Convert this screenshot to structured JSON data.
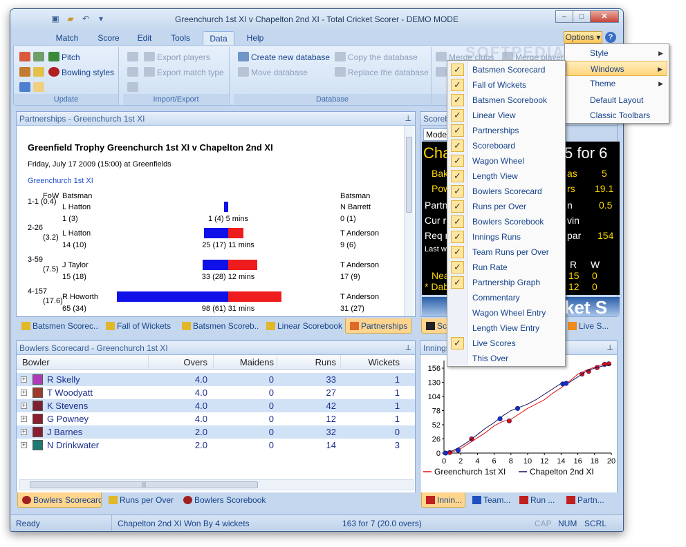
{
  "window": {
    "title": "Greenchurch 1st XI v Chapelton 2nd XI - Total Cricket Scorer - DEMO MODE"
  },
  "qat": {
    "more": "▾"
  },
  "ribbon_tabs": [
    "Match",
    "Score",
    "Edit",
    "Tools",
    "Data",
    "Help"
  ],
  "options_label": "Options ▾",
  "help_label": "?",
  "ribbon": {
    "update": {
      "label": "Update",
      "pitch": "Pitch",
      "bowling_styles": "Bowling styles"
    },
    "import_export": {
      "label": "Import/Export",
      "export_players": "Export players",
      "export_match_type": "Export match type"
    },
    "database": {
      "label": "Database",
      "create": "Create new database",
      "move": "Move database",
      "copy": "Copy the database",
      "replace": "Replace the database"
    },
    "merge_clubs": "Merge clubs",
    "merge_players": "Merge players"
  },
  "partnerships": {
    "header": "Partnerships - Greenchurch 1st XI",
    "title": "Greenfield Trophy Greenchurch 1st XI v Chapelton 2nd XI",
    "date": "Friday, July 17 2009 (15:00) at Greenfields",
    "team": "Greenchurch 1st XI",
    "col_fow": "FoW",
    "col_batsman": "Batsman",
    "col_batsman2": "Batsman",
    "rows": [
      {
        "fow": "1-1 (0.4)",
        "fow2": "",
        "b1": "L Hatton",
        "b1s": "1 (3)",
        "total": "1 (4) 5 mins",
        "b2": "N Barrett",
        "b2s": "0 (1)",
        "left": 1,
        "right": 0
      },
      {
        "fow": "2-26",
        "fow2": "(3.2)",
        "b1": "L Hatton",
        "b1s": "14 (10)",
        "total": "25 (17) 11 mins",
        "b2": "T Anderson",
        "b2s": "9 (6)",
        "left": 14,
        "right": 9
      },
      {
        "fow": "3-59",
        "fow2": "(7.5)",
        "b1": "J Taylor",
        "b1s": "15 (18)",
        "total": "33 (28) 12 mins",
        "b2": "T Anderson",
        "b2s": "17 (9)",
        "left": 15,
        "right": 17
      },
      {
        "fow": "4-157",
        "fow2": "(17.6)",
        "b1": "R Howorth",
        "b1s": "65 (34)",
        "total": "98 (61) 31 mins",
        "b2": "T Anderson",
        "b2s": "31 (27)",
        "left": 65,
        "right": 31
      }
    ]
  },
  "top_tabs": [
    "Batsmen Scorec...",
    "Fall of Wickets",
    "Batsmen Scoreb...",
    "Linear Scorebook",
    "Partnerships"
  ],
  "bowlers": {
    "header": "Bowlers Scorecard - Greenchurch 1st XI",
    "columns": [
      "Bowler",
      "Overs",
      "Maidens",
      "Runs",
      "Wickets"
    ],
    "rows": [
      {
        "name": "R Skelly",
        "overs": "4.0",
        "maidens": "0",
        "runs": "33",
        "wickets": "1",
        "color": "#b03ab8"
      },
      {
        "name": "T Woodyatt",
        "overs": "4.0",
        "maidens": "0",
        "runs": "27",
        "wickets": "1",
        "color": "#9e3a2a"
      },
      {
        "name": "K Stevens",
        "overs": "4.0",
        "maidens": "0",
        "runs": "42",
        "wickets": "1",
        "color": "#7a2030"
      },
      {
        "name": "G Powney",
        "overs": "4.0",
        "maidens": "0",
        "runs": "12",
        "wickets": "1",
        "color": "#8a1e2e"
      },
      {
        "name": "J Barnes",
        "overs": "2.0",
        "maidens": "0",
        "runs": "32",
        "wickets": "0",
        "color": "#8a1e2e"
      },
      {
        "name": "N Drinkwater",
        "overs": "2.0",
        "maidens": "0",
        "runs": "14",
        "wickets": "3",
        "color": "#1b7a72"
      }
    ]
  },
  "bottom_tabs": [
    "Bowlers Scorecard",
    "Runs per Over",
    "Bowlers Scorebook"
  ],
  "scoreboard": {
    "header": "Scorebo",
    "mode": "Mode",
    "team": "Cha",
    "score": "5 for 6",
    "lines": [
      {
        "l": "Bak",
        "r": "as",
        "v": "5"
      },
      {
        "l": "Pow",
        "r": "rs",
        "v": "19.1"
      },
      {
        "l": "Partn",
        "r": "n",
        "v": "0.5"
      },
      {
        "l": "Cur r",
        "r": "vin",
        "v": ""
      },
      {
        "l": "Req r",
        "r": "par",
        "v": "154"
      }
    ],
    "last": "Last w",
    "rw": {
      "r": "R",
      "w": "W"
    },
    "near": "Near",
    "near_r": "15",
    "near_w": "0",
    "dab": "* Dab",
    "dab_r": "12",
    "dab_w": "0",
    "banner": "ket S"
  },
  "right_tabs_top": [
    "Sco",
    "Live S..."
  ],
  "innings_header": "Innings",
  "right_tabs_bottom": [
    "Innin...",
    "Team...",
    "Run ...",
    "Partn..."
  ],
  "chart_data": {
    "type": "line",
    "title": "",
    "xlabel": "",
    "ylabel": "",
    "xlim": [
      0,
      20
    ],
    "ylim": [
      0,
      170
    ],
    "xticks": [
      0,
      2,
      4,
      6,
      8,
      10,
      12,
      14,
      16,
      18,
      20
    ],
    "yticks": [
      0,
      26,
      52,
      78,
      104,
      130,
      156
    ],
    "series": [
      {
        "name": "Greenchurch 1st XI",
        "color": "#e01010",
        "x": [
          0,
          1,
          2,
          3,
          4,
          5,
          6,
          7,
          8,
          9,
          10,
          11,
          12,
          13,
          14,
          15,
          16,
          17,
          18,
          19,
          19.5,
          20
        ],
        "y": [
          0,
          2,
          8,
          18,
          28,
          38,
          50,
          58,
          62,
          72,
          82,
          90,
          98,
          110,
          120,
          132,
          145,
          152,
          158,
          163,
          164,
          165
        ],
        "wickets_x": [
          0.7,
          3.3,
          7.8,
          16.5,
          17.3,
          18.3,
          19.2,
          19.7
        ],
        "wickets_y": [
          1,
          26,
          59,
          145,
          150,
          157,
          163,
          164
        ]
      },
      {
        "name": "Chapelton 2nd XI",
        "color": "#101060",
        "x": [
          0,
          1,
          2,
          3,
          4,
          5,
          6,
          7,
          8,
          9,
          10,
          11,
          12,
          13,
          14,
          15,
          16,
          17,
          18,
          19,
          20
        ],
        "y": [
          0,
          4,
          12,
          22,
          34,
          46,
          56,
          68,
          78,
          84,
          90,
          98,
          108,
          118,
          128,
          130,
          140,
          150,
          156,
          160,
          163
        ],
        "wickets_x": [
          0.2,
          1.7,
          6.7,
          8.8,
          14.2,
          14.6
        ],
        "wickets_y": [
          0,
          5,
          63,
          82,
          127,
          128
        ]
      }
    ]
  },
  "options_menu": {
    "items": [
      "Style",
      "Windows",
      "Theme",
      "Default Layout",
      "Classic Toolbars"
    ],
    "highlighted": "Windows"
  },
  "windows_menu": [
    {
      "label": "Batsmen Scorecard",
      "checked": true
    },
    {
      "label": "Fall of Wickets",
      "checked": true
    },
    {
      "label": "Batsmen Scorebook",
      "checked": true
    },
    {
      "label": "Linear View",
      "checked": true
    },
    {
      "label": "Partnerships",
      "checked": true
    },
    {
      "label": "Scoreboard",
      "checked": true
    },
    {
      "label": "Wagon Wheel",
      "checked": true
    },
    {
      "label": "Length View",
      "checked": true
    },
    {
      "label": "Bowlers Scorecard",
      "checked": true
    },
    {
      "label": "Runs per Over",
      "checked": true
    },
    {
      "label": "Bowlers Scorebook",
      "checked": true
    },
    {
      "label": "Innings Runs",
      "checked": true
    },
    {
      "label": "Team Runs per Over",
      "checked": true
    },
    {
      "label": "Run Rate",
      "checked": true
    },
    {
      "label": "Partnership Graph",
      "checked": true
    },
    {
      "label": "Commentary",
      "checked": false
    },
    {
      "label": "Wagon Wheel Entry",
      "checked": false
    },
    {
      "label": "Length View Entry",
      "checked": false
    },
    {
      "label": "Live Scores",
      "checked": true
    },
    {
      "label": "This Over",
      "checked": false
    }
  ],
  "status": {
    "ready": "Ready",
    "result": "Chapelton 2nd XI Won By 4 wickets",
    "score": "163 for 7  (20.0 overs)",
    "cap": "CAP",
    "num": "NUM",
    "scrl": "SCRL"
  },
  "watermark": "SOFTPEDIA"
}
